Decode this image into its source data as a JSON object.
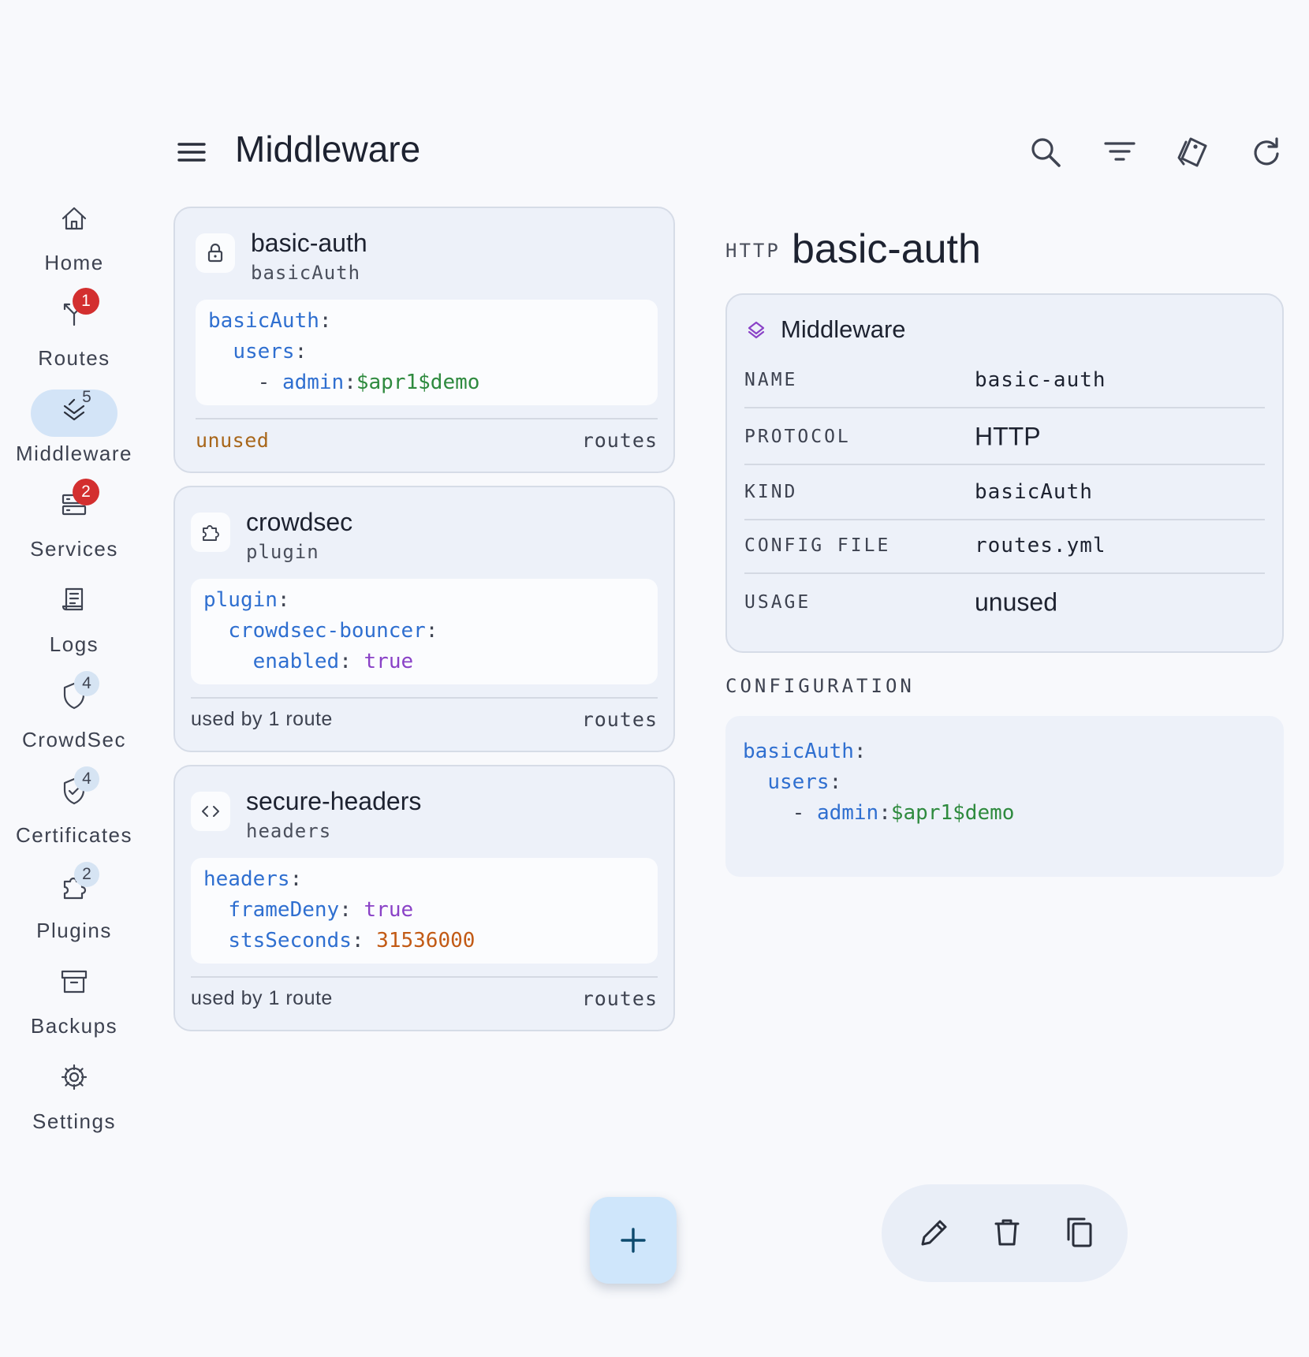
{
  "header": {
    "title": "Middleware"
  },
  "nav": {
    "items": [
      {
        "label": "Home"
      },
      {
        "label": "Routes",
        "badge": "1"
      },
      {
        "label": "Middleware",
        "badge": "5"
      },
      {
        "label": "Services",
        "badge": "2"
      },
      {
        "label": "Logs"
      },
      {
        "label": "CrowdSec",
        "badge": "4"
      },
      {
        "label": "Certificates",
        "badge": "4"
      },
      {
        "label": "Plugins",
        "badge": "2"
      },
      {
        "label": "Backups"
      },
      {
        "label": "Settings"
      }
    ],
    "active": "Middleware"
  },
  "toolbar_icons": [
    "search-icon",
    "filter-icon",
    "tag-icon",
    "refresh-icon"
  ],
  "cards": [
    {
      "name": "basic-auth",
      "kind": "basicAuth",
      "icon": "lock-icon",
      "code": {
        "l1_key": "basicAuth",
        "l1_colon": ":",
        "l2_key": "users",
        "l2_colon": ":",
        "l3_dash": "- ",
        "l3_key": "admin",
        "l3_colon": ":",
        "l3_val": "$apr1$demo"
      },
      "status": "unused",
      "routes_label": "routes"
    },
    {
      "name": "crowdsec",
      "kind": "plugin",
      "icon": "puzzle-icon",
      "code": {
        "l1_key": "plugin",
        "l1_colon": ":",
        "l2_key": "crowdsec-bouncer",
        "l2_colon": ":",
        "l3_key": "enabled",
        "l3_colon": ": ",
        "l3_val": "true"
      },
      "status": "used by 1 route",
      "routes_label": "routes"
    },
    {
      "name": "secure-headers",
      "kind": "headers",
      "icon": "code-icon",
      "code": {
        "l1_key": "headers",
        "l1_colon": ":",
        "l2_key": "frameDeny",
        "l2_colon": ": ",
        "l2_val": "true",
        "l3_key": "stsSeconds",
        "l3_colon": ": ",
        "l3_val": "31536000"
      },
      "status": "used by 1 route",
      "routes_label": "routes"
    }
  ],
  "detail": {
    "protocol_tag": "HTTP",
    "title": "basic-auth",
    "section_title": "Middleware",
    "rows": [
      {
        "key": "NAME",
        "value": "basic-auth"
      },
      {
        "key": "PROTOCOL",
        "value": "HTTP"
      },
      {
        "key": "KIND",
        "value": "basicAuth"
      },
      {
        "key": "CONFIG FILE",
        "value": "routes.yml"
      },
      {
        "key": "USAGE",
        "value": "unused"
      }
    ],
    "config_label": "CONFIGURATION",
    "config": {
      "l1_key": "basicAuth",
      "l1_colon": ":",
      "l2_key": "users",
      "l2_colon": ":",
      "l3_dash": "- ",
      "l3_key": "admin",
      "l3_colon": ":",
      "l3_val": "$apr1$demo"
    }
  },
  "actions": [
    "edit-icon",
    "delete-icon",
    "copy-icon"
  ],
  "colors": {
    "background": "#f8f9fc",
    "card": "#edf1f9",
    "active_nav": "#d3e4f7",
    "badge_red": "#d32f2f",
    "yaml_key": "#2f6fd0",
    "yaml_string": "#2e8a3e",
    "yaml_bool": "#8a42c7",
    "yaml_number": "#c25a15",
    "unused_status": "#a8661a",
    "fab": "#cfe6fb"
  }
}
